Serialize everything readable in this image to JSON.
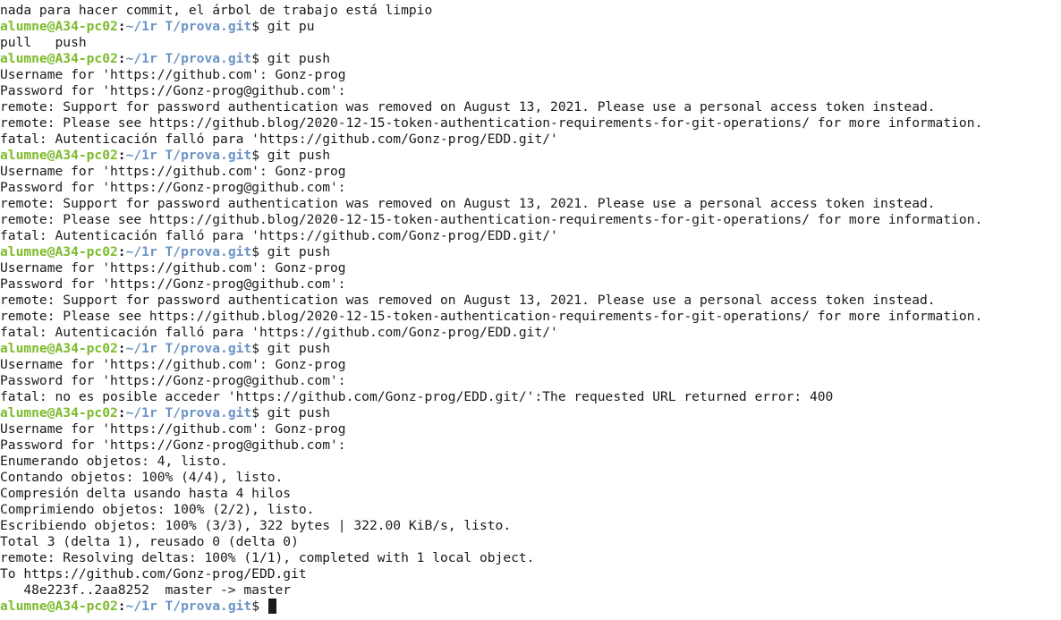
{
  "prompt": {
    "user_host": "alumne@A34-pc02",
    "separator": ":",
    "path": "~/1r T/prova.git",
    "symbol": "$ "
  },
  "lines": [
    {
      "type": "out",
      "text": "nada para hacer commit, el árbol de trabajo está limpio"
    },
    {
      "type": "prompt",
      "cmd": "git pu"
    },
    {
      "type": "out",
      "text": "pull   push"
    },
    {
      "type": "prompt",
      "cmd": "git push"
    },
    {
      "type": "out",
      "text": "Username for 'https://github.com': Gonz-prog"
    },
    {
      "type": "out",
      "text": "Password for 'https://Gonz-prog@github.com':"
    },
    {
      "type": "out",
      "text": "remote: Support for password authentication was removed on August 13, 2021. Please use a personal access token instead."
    },
    {
      "type": "out",
      "text": "remote: Please see https://github.blog/2020-12-15-token-authentication-requirements-for-git-operations/ for more information."
    },
    {
      "type": "out",
      "text": "fatal: Autenticación falló para 'https://github.com/Gonz-prog/EDD.git/'"
    },
    {
      "type": "prompt",
      "cmd": "git push"
    },
    {
      "type": "out",
      "text": "Username for 'https://github.com': Gonz-prog"
    },
    {
      "type": "out",
      "text": "Password for 'https://Gonz-prog@github.com':"
    },
    {
      "type": "out",
      "text": "remote: Support for password authentication was removed on August 13, 2021. Please use a personal access token instead."
    },
    {
      "type": "out",
      "text": "remote: Please see https://github.blog/2020-12-15-token-authentication-requirements-for-git-operations/ for more information."
    },
    {
      "type": "out",
      "text": "fatal: Autenticación falló para 'https://github.com/Gonz-prog/EDD.git/'"
    },
    {
      "type": "prompt",
      "cmd": "git push"
    },
    {
      "type": "out",
      "text": "Username for 'https://github.com': Gonz-prog"
    },
    {
      "type": "out",
      "text": "Password for 'https://Gonz-prog@github.com':"
    },
    {
      "type": "out",
      "text": "remote: Support for password authentication was removed on August 13, 2021. Please use a personal access token instead."
    },
    {
      "type": "out",
      "text": "remote: Please see https://github.blog/2020-12-15-token-authentication-requirements-for-git-operations/ for more information."
    },
    {
      "type": "out",
      "text": "fatal: Autenticación falló para 'https://github.com/Gonz-prog/EDD.git/'"
    },
    {
      "type": "prompt",
      "cmd": "git push"
    },
    {
      "type": "out",
      "text": "Username for 'https://github.com': Gonz-prog"
    },
    {
      "type": "out",
      "text": "Password for 'https://Gonz-prog@github.com':"
    },
    {
      "type": "out",
      "text": "fatal: no es posible acceder 'https://github.com/Gonz-prog/EDD.git/':The requested URL returned error: 400"
    },
    {
      "type": "prompt",
      "cmd": "git push"
    },
    {
      "type": "out",
      "text": "Username for 'https://github.com': Gonz-prog"
    },
    {
      "type": "out",
      "text": "Password for 'https://Gonz-prog@github.com':"
    },
    {
      "type": "out",
      "text": "Enumerando objetos: 4, listo."
    },
    {
      "type": "out",
      "text": "Contando objetos: 100% (4/4), listo."
    },
    {
      "type": "out",
      "text": "Compresión delta usando hasta 4 hilos"
    },
    {
      "type": "out",
      "text": "Comprimiendo objetos: 100% (2/2), listo."
    },
    {
      "type": "out",
      "text": "Escribiendo objetos: 100% (3/3), 322 bytes | 322.00 KiB/s, listo."
    },
    {
      "type": "out",
      "text": "Total 3 (delta 1), reusado 0 (delta 0)"
    },
    {
      "type": "out",
      "text": "remote: Resolving deltas: 100% (1/1), completed with 1 local object."
    },
    {
      "type": "out",
      "text": "To https://github.com/Gonz-prog/EDD.git"
    },
    {
      "type": "out",
      "text": "   48e223f..2aa8252  master -> master"
    },
    {
      "type": "prompt",
      "cmd": "",
      "cursor": true
    }
  ],
  "colors": {
    "background": "#ffffff",
    "text": "#1a1a1a",
    "user_host": "#7dbb2c",
    "path": "#6b93c6"
  }
}
